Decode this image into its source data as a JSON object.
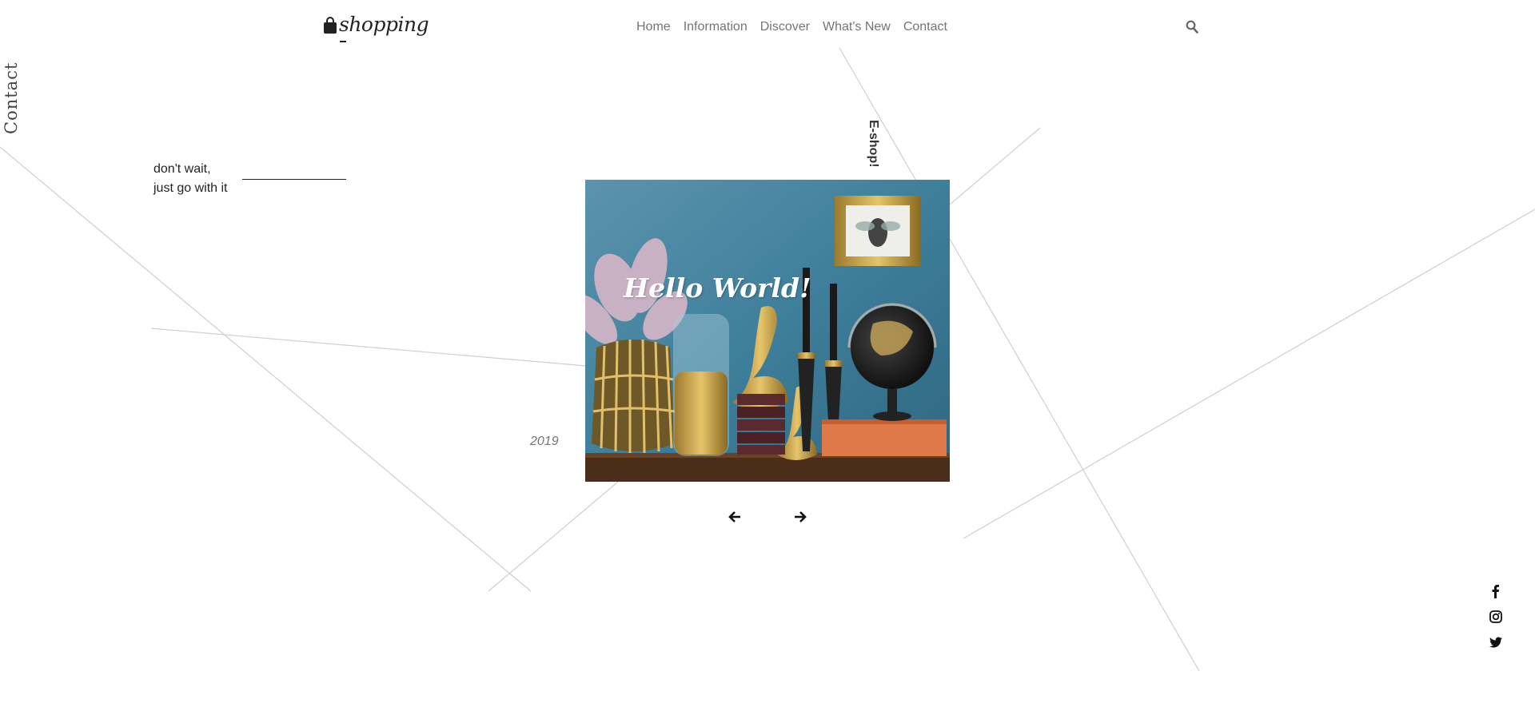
{
  "brand": {
    "logo_text": "shopping"
  },
  "nav": {
    "items": [
      {
        "label": "Home"
      },
      {
        "label": "Information"
      },
      {
        "label": "Discover"
      },
      {
        "label": "What's New"
      },
      {
        "label": "Contact"
      }
    ]
  },
  "side_label": "Contact",
  "tagline": {
    "line1": "don't wait,",
    "line2": "just go with it"
  },
  "year": "2019",
  "vertical_label": "E-shop!",
  "hero": {
    "title": "Hello World!"
  },
  "icons": {
    "logo": "shopping-bag-icon",
    "search": "search-icon",
    "prev": "arrow-left-icon",
    "next": "arrow-right-icon",
    "social": [
      "facebook-icon",
      "instagram-icon",
      "twitter-icon"
    ]
  },
  "colors": {
    "background": "#ffffff",
    "nav_text": "#757575",
    "text_dark": "#222222",
    "line": "#cfcfcf",
    "hero_wall": "#3e7f9b"
  }
}
